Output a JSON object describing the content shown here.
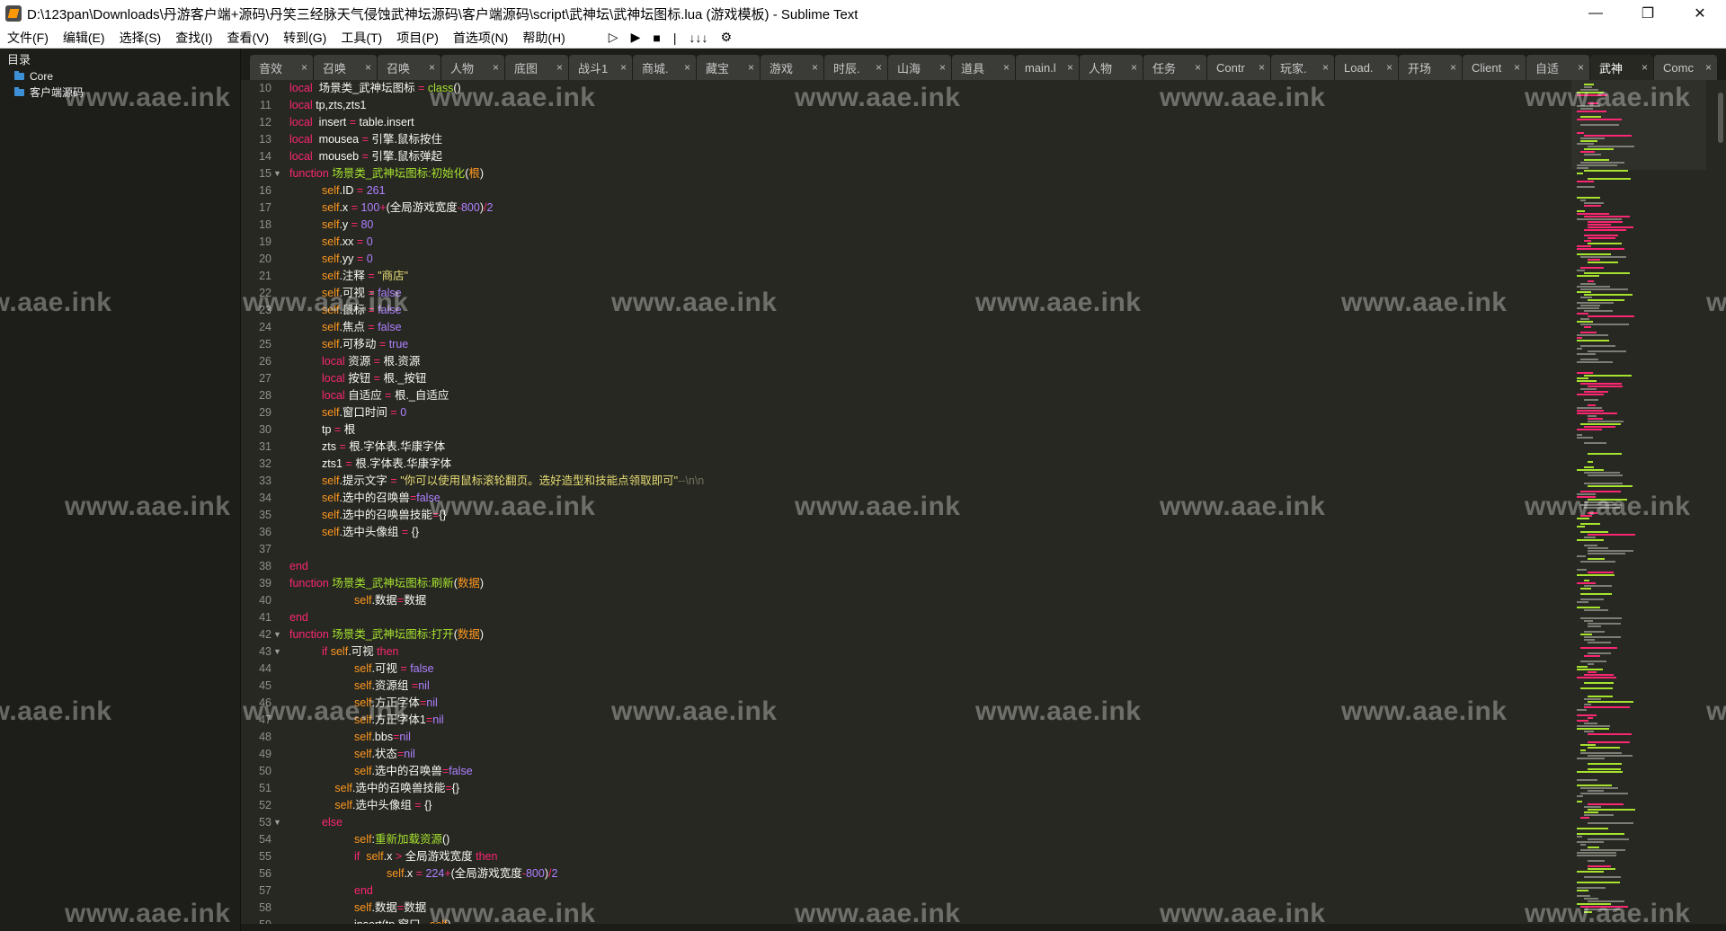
{
  "window": {
    "title": "D:\\123pan\\Downloads\\丹游客户端+源码\\丹笑三经脉天气侵蚀武神坛源码\\客户端源码\\script\\武神坛\\武神坛图标.lua (游戏模板) - Sublime Text",
    "controls": [
      "—",
      "❐",
      "✕"
    ]
  },
  "menu": [
    "文件(F)",
    "编辑(E)",
    "选择(S)",
    "查找(I)",
    "查看(V)",
    "转到(G)",
    "工具(T)",
    "项目(P)",
    "首选项(N)",
    "帮助(H)"
  ],
  "toolbar": [
    "▷",
    "▶",
    "■",
    "|",
    "↓↓↓",
    "⚙"
  ],
  "sidebar": {
    "title": "目录",
    "items": [
      {
        "label": "Core"
      },
      {
        "label": "客户端源码"
      }
    ]
  },
  "tabs": [
    {
      "label": "音效",
      "active": false
    },
    {
      "label": "召唤",
      "active": false
    },
    {
      "label": "召唤",
      "active": false
    },
    {
      "label": "人物",
      "active": false
    },
    {
      "label": "底图",
      "active": false
    },
    {
      "label": "战斗1",
      "active": false
    },
    {
      "label": "商城.",
      "active": false
    },
    {
      "label": "藏宝",
      "active": false
    },
    {
      "label": "游戏",
      "active": false
    },
    {
      "label": "时辰.",
      "active": false
    },
    {
      "label": "山海",
      "active": false
    },
    {
      "label": "道具",
      "active": false
    },
    {
      "label": "main.l",
      "active": false
    },
    {
      "label": "人物",
      "active": false
    },
    {
      "label": "任务",
      "active": false
    },
    {
      "label": "Contr",
      "active": false
    },
    {
      "label": "玩家.",
      "active": false
    },
    {
      "label": "Load.",
      "active": false
    },
    {
      "label": "开场",
      "active": false
    },
    {
      "label": "Client",
      "active": false
    },
    {
      "label": "自适",
      "active": false
    },
    {
      "label": "武神",
      "active": true
    },
    {
      "label": "Comc",
      "active": false
    }
  ],
  "code": [
    {
      "n": "10",
      "fold": "",
      "indent": 0,
      "parts": [
        [
          "kw",
          "local"
        ],
        [
          "",
          "  场景类_武神坛图标 "
        ],
        [
          "op",
          "="
        ],
        [
          "fn",
          " class"
        ],
        [
          "",
          "()"
        ]
      ]
    },
    {
      "n": "11",
      "fold": "",
      "indent": 0,
      "parts": [
        [
          "kw",
          "local"
        ],
        [
          "",
          "",
          " "
        ],
        [
          "",
          "tp,zts,zts1"
        ]
      ]
    },
    {
      "n": "12",
      "fold": "",
      "indent": 0,
      "parts": [
        [
          "kw",
          "local"
        ],
        [
          "",
          "  insert "
        ],
        [
          "op",
          "="
        ],
        [
          "",
          " table.insert"
        ]
      ]
    },
    {
      "n": "13",
      "fold": "",
      "indent": 0,
      "parts": [
        [
          "kw",
          "local"
        ],
        [
          "",
          "  mousea "
        ],
        [
          "op",
          "="
        ],
        [
          "",
          " 引擎.鼠标按住"
        ]
      ]
    },
    {
      "n": "14",
      "fold": "",
      "indent": 0,
      "parts": [
        [
          "kw",
          "local"
        ],
        [
          "",
          "  mouseb "
        ],
        [
          "op",
          "="
        ],
        [
          "",
          " 引擎.鼠标弹起"
        ]
      ]
    },
    {
      "n": "15",
      "fold": "▼",
      "indent": 0,
      "parts": [
        [
          "kw",
          "function"
        ],
        [
          "fn",
          " 场景类_武神坛图标:初始化"
        ],
        [
          "",
          "("
        ],
        [
          "self",
          "根"
        ],
        [
          "",
          ")"
        ]
      ]
    },
    {
      "n": "16",
      "fold": "",
      "indent": 1,
      "parts": [
        [
          "self",
          "self"
        ],
        [
          "",
          ".ID "
        ],
        [
          "op",
          "="
        ],
        [
          "num",
          " 261"
        ]
      ]
    },
    {
      "n": "17",
      "fold": "",
      "indent": 1,
      "parts": [
        [
          "self",
          "self"
        ],
        [
          "",
          ".x "
        ],
        [
          "op",
          "="
        ],
        [
          "num",
          " 100"
        ],
        [
          "op",
          "+"
        ],
        [
          "",
          "(全局游戏宽度"
        ],
        [
          "op",
          "-"
        ],
        [
          "num",
          "800"
        ],
        [
          "",
          ")"
        ],
        [
          "op",
          "/"
        ],
        [
          "num",
          "2"
        ]
      ]
    },
    {
      "n": "18",
      "fold": "",
      "indent": 1,
      "parts": [
        [
          "self",
          "self"
        ],
        [
          "",
          ".y "
        ],
        [
          "op",
          "="
        ],
        [
          "num",
          " 80"
        ]
      ]
    },
    {
      "n": "19",
      "fold": "",
      "indent": 1,
      "parts": [
        [
          "self",
          "self"
        ],
        [
          "",
          ".xx "
        ],
        [
          "op",
          "="
        ],
        [
          "num",
          " 0"
        ]
      ]
    },
    {
      "n": "20",
      "fold": "",
      "indent": 1,
      "parts": [
        [
          "self",
          "self"
        ],
        [
          "",
          ".yy "
        ],
        [
          "op",
          "="
        ],
        [
          "num",
          " 0"
        ]
      ]
    },
    {
      "n": "21",
      "fold": "",
      "indent": 1,
      "parts": [
        [
          "self",
          "self"
        ],
        [
          "",
          ".注释 "
        ],
        [
          "op",
          "="
        ],
        [
          "str",
          " \"商店\""
        ]
      ]
    },
    {
      "n": "22",
      "fold": "",
      "indent": 1,
      "parts": [
        [
          "self",
          "self"
        ],
        [
          "",
          ".可视 "
        ],
        [
          "op",
          "="
        ],
        [
          "num",
          " false"
        ]
      ]
    },
    {
      "n": "23",
      "fold": "",
      "indent": 1,
      "parts": [
        [
          "self",
          "self"
        ],
        [
          "",
          ".鼠标 "
        ],
        [
          "op",
          "="
        ],
        [
          "num",
          " false"
        ]
      ]
    },
    {
      "n": "24",
      "fold": "",
      "indent": 1,
      "parts": [
        [
          "self",
          "self"
        ],
        [
          "",
          ".焦点 "
        ],
        [
          "op",
          "="
        ],
        [
          "num",
          " false"
        ]
      ]
    },
    {
      "n": "25",
      "fold": "",
      "indent": 1,
      "parts": [
        [
          "self",
          "self"
        ],
        [
          "",
          ".可移动 "
        ],
        [
          "op",
          "="
        ],
        [
          "num",
          " true"
        ]
      ]
    },
    {
      "n": "26",
      "fold": "",
      "indent": 1,
      "parts": [
        [
          "kw",
          "local"
        ],
        [
          "",
          " 资源 "
        ],
        [
          "op",
          "="
        ],
        [
          "",
          " 根.资源"
        ]
      ]
    },
    {
      "n": "27",
      "fold": "",
      "indent": 1,
      "parts": [
        [
          "kw",
          "local"
        ],
        [
          "",
          " 按钮 "
        ],
        [
          "op",
          "="
        ],
        [
          "",
          " 根._按钮"
        ]
      ]
    },
    {
      "n": "28",
      "fold": "",
      "indent": 1,
      "parts": [
        [
          "kw",
          "local"
        ],
        [
          "",
          " 自适应 "
        ],
        [
          "op",
          "="
        ],
        [
          "",
          " 根._自适应"
        ]
      ]
    },
    {
      "n": "29",
      "fold": "",
      "indent": 1,
      "parts": [
        [
          "self",
          "self"
        ],
        [
          "",
          ".窗口时间 "
        ],
        [
          "op",
          "="
        ],
        [
          "num",
          " 0"
        ]
      ]
    },
    {
      "n": "30",
      "fold": "",
      "indent": 1,
      "parts": [
        [
          "",
          "tp "
        ],
        [
          "op",
          "="
        ],
        [
          "",
          " 根"
        ]
      ]
    },
    {
      "n": "31",
      "fold": "",
      "indent": 1,
      "parts": [
        [
          "",
          "zts "
        ],
        [
          "op",
          "="
        ],
        [
          "",
          " 根.字体表.华康字体"
        ]
      ]
    },
    {
      "n": "32",
      "fold": "",
      "indent": 1,
      "parts": [
        [
          "",
          "zts1 "
        ],
        [
          "op",
          "="
        ],
        [
          "",
          " 根.字体表.华康字体"
        ]
      ]
    },
    {
      "n": "33",
      "fold": "",
      "indent": 1,
      "parts": [
        [
          "self",
          "self"
        ],
        [
          "",
          ".提示文字 "
        ],
        [
          "op",
          "="
        ],
        [
          "str",
          " \"你可以使用鼠标滚轮翻页。选好造型和技能点领取即可\""
        ],
        [
          "cm",
          "--\\n\\n"
        ]
      ]
    },
    {
      "n": "34",
      "fold": "",
      "indent": 1,
      "parts": [
        [
          "self",
          "self"
        ],
        [
          "",
          ".选中的召唤兽"
        ],
        [
          "op",
          "="
        ],
        [
          "num",
          "false"
        ]
      ]
    },
    {
      "n": "35",
      "fold": "",
      "indent": 1,
      "parts": [
        [
          "self",
          "self"
        ],
        [
          "",
          ".选中的召唤兽技能"
        ],
        [
          "op",
          "="
        ],
        [
          "",
          "{}"
        ]
      ]
    },
    {
      "n": "36",
      "fold": "",
      "indent": 1,
      "parts": [
        [
          "self",
          "self"
        ],
        [
          "",
          ".选中头像组 "
        ],
        [
          "op",
          "="
        ],
        [
          "",
          " {}"
        ]
      ]
    },
    {
      "n": "37",
      "fold": "",
      "indent": 0,
      "parts": []
    },
    {
      "n": "38",
      "fold": "",
      "indent": 0,
      "parts": [
        [
          "kw",
          "end"
        ]
      ]
    },
    {
      "n": "39",
      "fold": "",
      "indent": 0,
      "parts": [
        [
          "kw",
          "function"
        ],
        [
          "fn",
          " 场景类_武神坛图标:刷新"
        ],
        [
          "",
          "("
        ],
        [
          "self",
          "数据"
        ],
        [
          "",
          ")"
        ]
      ]
    },
    {
      "n": "40",
      "fold": "",
      "indent": 2,
      "parts": [
        [
          "self",
          "self"
        ],
        [
          "",
          ".数据"
        ],
        [
          "op",
          "="
        ],
        [
          "",
          "数据"
        ]
      ]
    },
    {
      "n": "41",
      "fold": "",
      "indent": 0,
      "parts": [
        [
          "kw",
          "end"
        ]
      ]
    },
    {
      "n": "42",
      "fold": "▼",
      "indent": 0,
      "parts": [
        [
          "kw",
          "function"
        ],
        [
          "fn",
          " 场景类_武神坛图标:打开"
        ],
        [
          "",
          "("
        ],
        [
          "self",
          "数据"
        ],
        [
          "",
          ")"
        ]
      ]
    },
    {
      "n": "43",
      "fold": "▼",
      "indent": 1,
      "parts": [
        [
          "kw",
          "if"
        ],
        [
          "self",
          " self"
        ],
        [
          "",
          ".可视 "
        ],
        [
          "kw",
          "then"
        ]
      ]
    },
    {
      "n": "44",
      "fold": "",
      "indent": 2,
      "parts": [
        [
          "self",
          "self"
        ],
        [
          "",
          ".可视 "
        ],
        [
          "op",
          "="
        ],
        [
          "num",
          " false"
        ]
      ]
    },
    {
      "n": "45",
      "fold": "",
      "indent": 2,
      "parts": [
        [
          "self",
          "self"
        ],
        [
          "",
          ".资源组 "
        ],
        [
          "op",
          "="
        ],
        [
          "num",
          "nil"
        ]
      ]
    },
    {
      "n": "46",
      "fold": "",
      "indent": 2,
      "parts": [
        [
          "self",
          "self"
        ],
        [
          "",
          ".方正字体"
        ],
        [
          "op",
          "="
        ],
        [
          "num",
          "nil"
        ]
      ]
    },
    {
      "n": "47",
      "fold": "",
      "indent": 2,
      "parts": [
        [
          "self",
          "self"
        ],
        [
          "",
          ".方正字体1"
        ],
        [
          "op",
          "="
        ],
        [
          "num",
          "nil"
        ]
      ]
    },
    {
      "n": "48",
      "fold": "",
      "indent": 2,
      "parts": [
        [
          "self",
          "self"
        ],
        [
          "",
          ".bbs"
        ],
        [
          "op",
          "="
        ],
        [
          "num",
          "nil"
        ]
      ]
    },
    {
      "n": "49",
      "fold": "",
      "indent": 2,
      "parts": [
        [
          "self",
          "self"
        ],
        [
          "",
          ".状态"
        ],
        [
          "op",
          "="
        ],
        [
          "num",
          "nil"
        ]
      ]
    },
    {
      "n": "50",
      "fold": "",
      "indent": 2,
      "parts": [
        [
          "self",
          "self"
        ],
        [
          "",
          ".选中的召唤兽"
        ],
        [
          "op",
          "="
        ],
        [
          "num",
          "false"
        ]
      ]
    },
    {
      "n": "51",
      "fold": "",
      "indent": 1.4,
      "parts": [
        [
          "self",
          "self"
        ],
        [
          "",
          ".选中的召唤兽技能"
        ],
        [
          "op",
          "="
        ],
        [
          "",
          "{}"
        ]
      ]
    },
    {
      "n": "52",
      "fold": "",
      "indent": 1.4,
      "parts": [
        [
          "self",
          "self"
        ],
        [
          "",
          ".选中头像组 "
        ],
        [
          "op",
          "="
        ],
        [
          "",
          " {}"
        ]
      ]
    },
    {
      "n": "53",
      "fold": "▼",
      "indent": 1,
      "parts": [
        [
          "kw",
          "else"
        ]
      ]
    },
    {
      "n": "54",
      "fold": "",
      "indent": 2,
      "parts": [
        [
          "self",
          "self"
        ],
        [
          "",
          ":"
        ],
        [
          "fn",
          "重新加载资源"
        ],
        [
          "",
          "()"
        ]
      ]
    },
    {
      "n": "55",
      "fold": "",
      "indent": 2,
      "parts": [
        [
          "kw",
          "if"
        ],
        [
          "self",
          "  self"
        ],
        [
          "",
          ".x "
        ],
        [
          "op",
          ">"
        ],
        [
          "",
          " 全局游戏宽度 "
        ],
        [
          "kw",
          "then"
        ]
      ]
    },
    {
      "n": "56",
      "fold": "",
      "indent": 3,
      "parts": [
        [
          "self",
          "self"
        ],
        [
          "",
          ".x "
        ],
        [
          "op",
          "="
        ],
        [
          "num",
          " 224"
        ],
        [
          "op",
          "+"
        ],
        [
          "",
          "(全局游戏宽度"
        ],
        [
          "op",
          "-"
        ],
        [
          "num",
          "800"
        ],
        [
          "",
          ")"
        ],
        [
          "op",
          "/"
        ],
        [
          "num",
          "2"
        ]
      ]
    },
    {
      "n": "57",
      "fold": "",
      "indent": 2,
      "parts": [
        [
          "kw",
          "end"
        ]
      ]
    },
    {
      "n": "58",
      "fold": "",
      "indent": 2,
      "parts": [
        [
          "self",
          "self"
        ],
        [
          "",
          ".数据"
        ],
        [
          "op",
          "="
        ],
        [
          "",
          "数据"
        ]
      ]
    },
    {
      "n": "59",
      "fold": "",
      "indent": 2,
      "parts": [
        [
          "",
          "insert(tp.窗口_,"
        ],
        [
          "self",
          "self"
        ],
        [
          "",
          ")"
        ]
      ]
    }
  ],
  "watermark": "www.aae.ink"
}
